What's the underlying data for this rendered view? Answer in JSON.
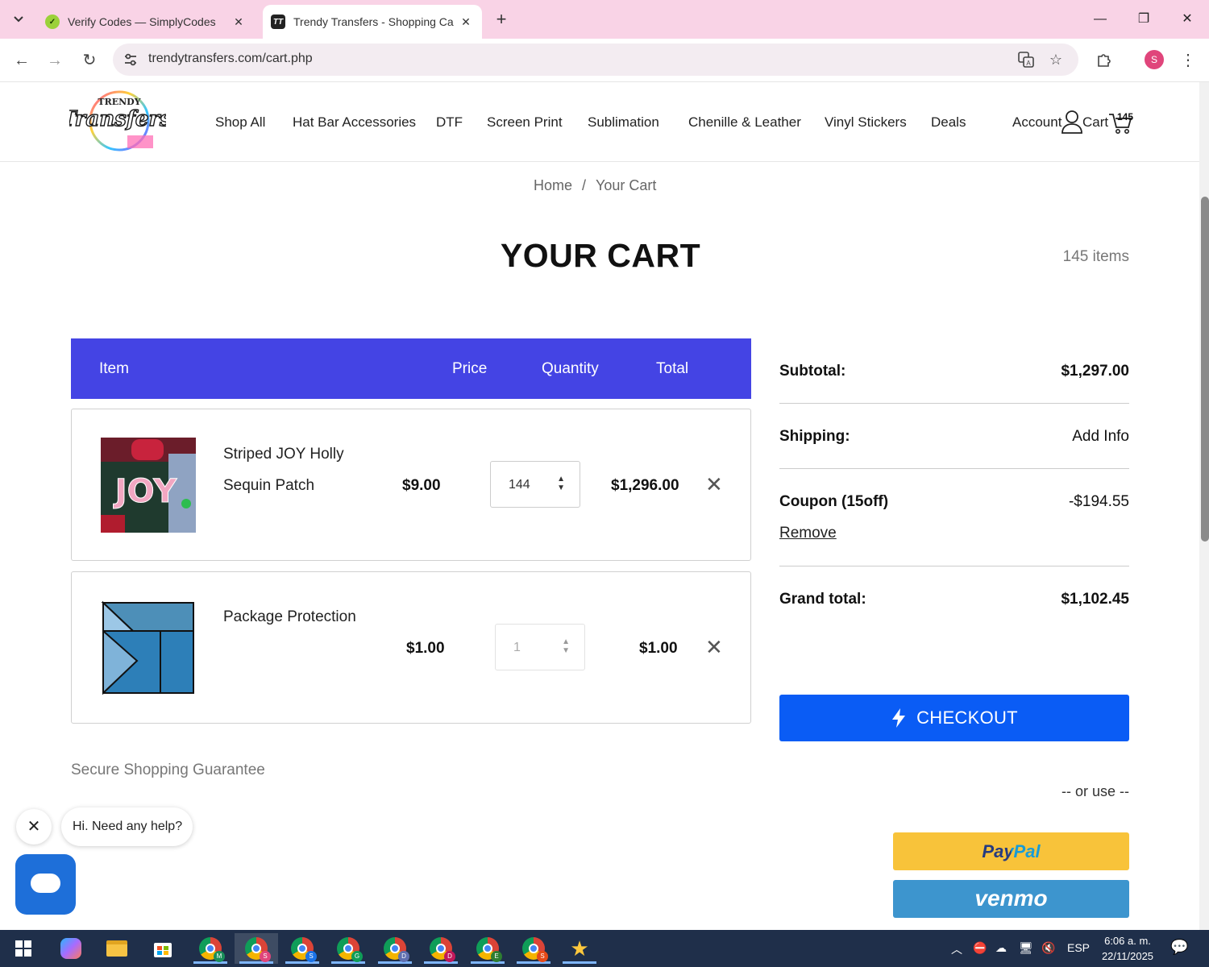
{
  "browser": {
    "tabs": [
      {
        "title": "Verify Codes — SimplyCodes",
        "active": false
      },
      {
        "title": "Trendy Transfers - Shopping Ca",
        "active": true
      }
    ],
    "url": "trendytransfers.com/cart.php",
    "profile_initial": "S"
  },
  "site": {
    "logo_text_top": "TRENDY",
    "logo_text_main": "Transfers",
    "nav": [
      "Shop All",
      "Hat Bar Accessories",
      "DTF",
      "Screen Print",
      "Sublimation",
      "Chenille & Leather",
      "Vinyl Stickers",
      "Deals"
    ],
    "account_label": "Account",
    "cart_label": "Cart",
    "cart_badge": "145"
  },
  "breadcrumb": {
    "home": "Home",
    "separator": "/",
    "current": "Your Cart"
  },
  "cart": {
    "title": "YOUR CART",
    "items_count": "145 items",
    "headers": {
      "item": "Item",
      "price": "Price",
      "quantity": "Quantity",
      "total": "Total"
    },
    "items": [
      {
        "name_line1": "Striped JOY Holly",
        "name_line2": "Sequin Patch",
        "price": "$9.00",
        "quantity": "144",
        "total": "$1,296.00"
      },
      {
        "name_line1": "Package Protection",
        "name_line2": "",
        "price": "$1.00",
        "quantity": "1",
        "total": "$1.00"
      }
    ],
    "secure_text": "Secure Shopping Guarantee"
  },
  "summary": {
    "subtotal_label": "Subtotal:",
    "subtotal_value": "$1,297.00",
    "shipping_label": "Shipping:",
    "shipping_value": "Add Info",
    "coupon_label": "Coupon (15off)",
    "coupon_value": "-$194.55",
    "coupon_remove": "Remove",
    "grand_total_label": "Grand total:",
    "grand_total_value": "$1,102.45",
    "checkout_label": "CHECKOUT",
    "or_use": "-- or use --",
    "paypal_label": "PayPal",
    "venmo_label": "venmo"
  },
  "chat": {
    "greeting": "Hi. Need any help?"
  },
  "taskbar": {
    "language": "ESP",
    "time": "6:06 a. m.",
    "date": "22/11/2025",
    "chrome_badges": [
      "M",
      "S",
      "S",
      "G",
      "D",
      "D",
      "E",
      "S"
    ]
  },
  "colors": {
    "accent": "#4444e4",
    "checkout": "#0a5cf5",
    "tabbar": "#f9d3e6",
    "paypal": "#f8c33a",
    "venmo": "#3d95ce"
  }
}
